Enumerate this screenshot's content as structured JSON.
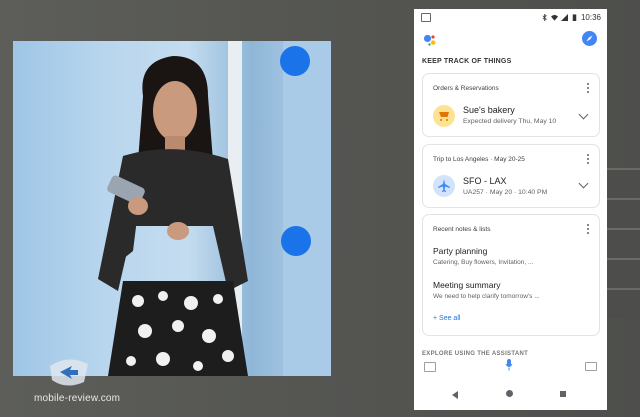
{
  "watermark": "mobile-review.com",
  "status": {
    "time": "10:36"
  },
  "assistant": {
    "section_title": "KEEP TRACK OF THINGS",
    "cards": [
      {
        "caption": "Orders & Reservations",
        "title": "Sue's bakery",
        "subtitle": "Expected delivery Thu, May 10",
        "icon": "cart-icon"
      },
      {
        "caption": "Trip to Los Angeles · May 20-25",
        "title": "SFO - LAX",
        "subtitle": "UA257 · May 20 · 10:40 PM",
        "icon": "airplane-icon"
      }
    ],
    "notes": {
      "caption": "Recent notes & lists",
      "items": [
        {
          "title": "Party planning",
          "subtitle": "Catering, Buy flowers, Invitation, ..."
        },
        {
          "title": "Meeting summary",
          "subtitle": "We need to help clarify tomorrow's ..."
        }
      ],
      "see_all": "+ See all"
    },
    "peek": "EXPLORE USING THE ASSISTANT"
  },
  "colors": {
    "accent": "#1a73e8",
    "cart_bg": "#fde293",
    "plane_bg": "#d2e3fc"
  }
}
